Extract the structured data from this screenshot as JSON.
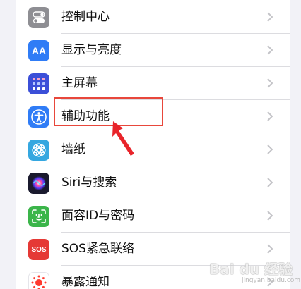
{
  "settings": {
    "items": [
      {
        "label": "控制中心",
        "icon": "toggles-icon",
        "color": "#8e8e93"
      },
      {
        "label": "显示与亮度",
        "icon": "aa-icon",
        "icon_text": "AA",
        "color": "#2f7cf6"
      },
      {
        "label": "主屏幕",
        "icon": "home-grid-icon",
        "color": "#3b4fd8"
      },
      {
        "label": "辅助功能",
        "icon": "accessibility-icon",
        "color": "#2f7cf6"
      },
      {
        "label": "墙纸",
        "icon": "flower-icon",
        "color": "#35a7e0"
      },
      {
        "label": "Siri与搜索",
        "icon": "siri-icon",
        "color": "#1a1a2e"
      },
      {
        "label": "面容ID与密码",
        "icon": "face-id-icon",
        "color": "#3bb54a"
      },
      {
        "label": "SOS紧急联络",
        "icon": "sos-icon",
        "icon_text": "SOS",
        "color": "#e53935"
      },
      {
        "label": "暴露通知",
        "icon": "exposure-icon",
        "color": "#ffffff"
      }
    ]
  },
  "highlight_color": "#e8473b",
  "watermark": {
    "text": "Bai du 经验",
    "url": "jingyan.baidu.com"
  }
}
